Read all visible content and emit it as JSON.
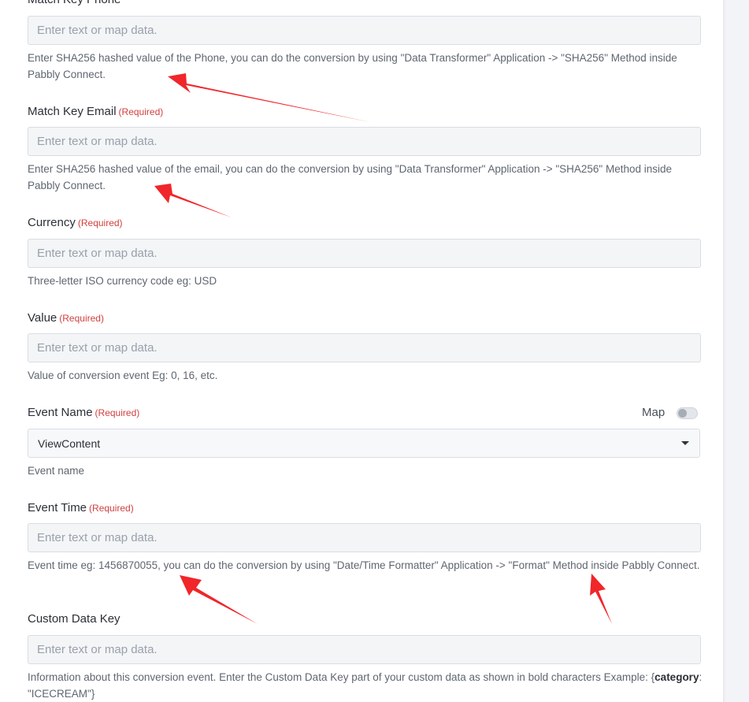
{
  "fields": {
    "phone": {
      "label": "Match Key Phone",
      "placeholder": "Enter text or map data.",
      "help": "Enter SHA256 hashed value of the Phone, you can do the conversion by using \"Data Transformer\" Application -> \"SHA256\" Method inside Pabbly Connect."
    },
    "email": {
      "label": "Match Key Email",
      "required": "(Required)",
      "placeholder": "Enter text or map data.",
      "help": "Enter SHA256 hashed value of the email, you can do the conversion by using \"Data Transformer\" Application -> \"SHA256\" Method inside Pabbly Connect."
    },
    "currency": {
      "label": "Currency",
      "required": "(Required)",
      "placeholder": "Enter text or map data.",
      "help": "Three-letter ISO currency code eg: USD"
    },
    "value": {
      "label": "Value",
      "required": "(Required)",
      "placeholder": "Enter text or map data.",
      "help": "Value of conversion event Eg: 0, 16, etc."
    },
    "event_name": {
      "label": "Event Name",
      "required": "(Required)",
      "map_label": "Map",
      "map_enabled": false,
      "selected": "ViewContent",
      "help": "Event name"
    },
    "event_time": {
      "label": "Event Time",
      "required": "(Required)",
      "placeholder": "Enter text or map data.",
      "help": "Event time eg: 1456870055, you can do the conversion by using \"Date/Time Formatter\" Application -> \"Format\" Method inside Pabbly Connect."
    },
    "custom_data_key": {
      "label": "Custom Data Key",
      "placeholder": "Enter text or map data.",
      "help_prefix": "Information about this conversion event. Enter the Custom Data Key part of your custom data as shown in bold characters Example: {",
      "help_bold": "category",
      "help_suffix": ": \"ICECREAM\"}"
    }
  },
  "colors": {
    "arrow": "#f0262a",
    "required": "#d23f3f"
  }
}
